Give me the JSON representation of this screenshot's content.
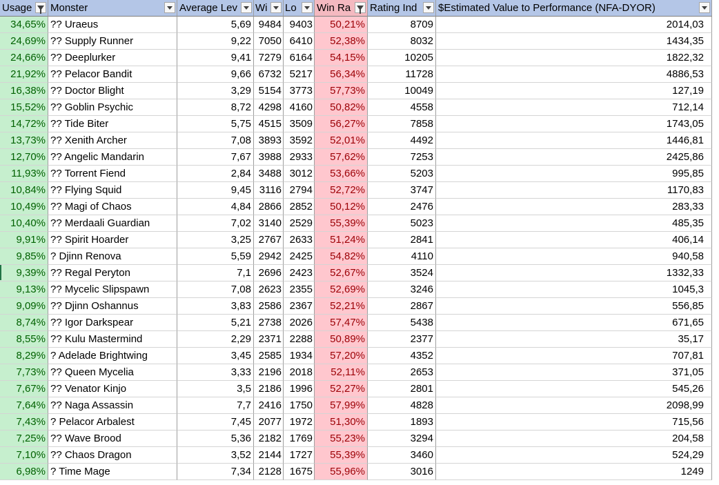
{
  "headers": {
    "usage": "Usage",
    "monster": "Monster",
    "avg_level": "Average Lev",
    "wins": "Wi",
    "losses": "Lo",
    "win_rate": "Win Ra",
    "rating": "Rating Ind",
    "value": "$Estimated Value to Performance (NFA-DYOR)"
  },
  "header_icons": {
    "usage": "filter-active-icon",
    "monster": "dropdown-arrow-icon",
    "avg_level": "dropdown-arrow-icon",
    "wins": "dropdown-arrow-icon",
    "losses": "dropdown-arrow-icon",
    "win_rate": "filter-active-icon",
    "rating": "dropdown-arrow-icon",
    "value": "dropdown-arrow-icon"
  },
  "colors": {
    "header_fill": "#b4c6e7",
    "win_rate_header_fill": "#f4b9c0",
    "usage_fill": "#c6efce",
    "usage_text": "#006100",
    "win_rate_fill": "#ffc7ce",
    "win_rate_text": "#9c0006"
  },
  "rows": [
    {
      "usage": "34,65%",
      "monster": "?? Uraeus",
      "avg": "5,69",
      "wins": "9484",
      "losses": "9403",
      "win_rate": "50,21%",
      "rating": "8709",
      "value": "2014,03"
    },
    {
      "usage": "24,69%",
      "monster": "?? Supply Runner",
      "avg": "9,22",
      "wins": "7050",
      "losses": "6410",
      "win_rate": "52,38%",
      "rating": "8032",
      "value": "1434,35"
    },
    {
      "usage": "24,66%",
      "monster": "?? Deeplurker",
      "avg": "9,41",
      "wins": "7279",
      "losses": "6164",
      "win_rate": "54,15%",
      "rating": "10205",
      "value": "1822,32"
    },
    {
      "usage": "21,92%",
      "monster": "?? Pelacor Bandit",
      "avg": "9,66",
      "wins": "6732",
      "losses": "5217",
      "win_rate": "56,34%",
      "rating": "11728",
      "value": "4886,53"
    },
    {
      "usage": "16,38%",
      "monster": "?? Doctor Blight",
      "avg": "3,29",
      "wins": "5154",
      "losses": "3773",
      "win_rate": "57,73%",
      "rating": "10049",
      "value": "127,19"
    },
    {
      "usage": "15,52%",
      "monster": "?? Goblin Psychic",
      "avg": "8,72",
      "wins": "4298",
      "losses": "4160",
      "win_rate": "50,82%",
      "rating": "4558",
      "value": "712,14"
    },
    {
      "usage": "14,72%",
      "monster": "?? Tide Biter",
      "avg": "5,75",
      "wins": "4515",
      "losses": "3509",
      "win_rate": "56,27%",
      "rating": "7858",
      "value": "1743,05"
    },
    {
      "usage": "13,73%",
      "monster": "?? Xenith Archer",
      "avg": "7,08",
      "wins": "3893",
      "losses": "3592",
      "win_rate": "52,01%",
      "rating": "4492",
      "value": "1446,81"
    },
    {
      "usage": "12,70%",
      "monster": "?? Angelic Mandarin",
      "avg": "7,67",
      "wins": "3988",
      "losses": "2933",
      "win_rate": "57,62%",
      "rating": "7253",
      "value": "2425,86"
    },
    {
      "usage": "11,93%",
      "monster": "?? Torrent Fiend",
      "avg": "2,84",
      "wins": "3488",
      "losses": "3012",
      "win_rate": "53,66%",
      "rating": "5203",
      "value": "995,85"
    },
    {
      "usage": "10,84%",
      "monster": "?? Flying Squid",
      "avg": "9,45",
      "wins": "3116",
      "losses": "2794",
      "win_rate": "52,72%",
      "rating": "3747",
      "value": "1170,83"
    },
    {
      "usage": "10,49%",
      "monster": "?? Magi of Chaos",
      "avg": "4,84",
      "wins": "2866",
      "losses": "2852",
      "win_rate": "50,12%",
      "rating": "2476",
      "value": "283,33"
    },
    {
      "usage": "10,40%",
      "monster": "?? Merdaali Guardian",
      "avg": "7,02",
      "wins": "3140",
      "losses": "2529",
      "win_rate": "55,39%",
      "rating": "5023",
      "value": "485,35"
    },
    {
      "usage": "9,91%",
      "monster": "?? Spirit Hoarder",
      "avg": "3,25",
      "wins": "2767",
      "losses": "2633",
      "win_rate": "51,24%",
      "rating": "2841",
      "value": "406,14"
    },
    {
      "usage": "9,85%",
      "monster": "? Djinn Renova",
      "avg": "5,59",
      "wins": "2942",
      "losses": "2425",
      "win_rate": "54,82%",
      "rating": "4110",
      "value": "940,58"
    },
    {
      "usage": "9,39%",
      "monster": "?? Regal Peryton",
      "avg": "7,1",
      "wins": "2696",
      "losses": "2423",
      "win_rate": "52,67%",
      "rating": "3524",
      "value": "1332,33"
    },
    {
      "usage": "9,13%",
      "monster": "?? Mycelic Slipspawn",
      "avg": "7,08",
      "wins": "2623",
      "losses": "2355",
      "win_rate": "52,69%",
      "rating": "3246",
      "value": "1045,3"
    },
    {
      "usage": "9,09%",
      "monster": "?? Djinn Oshannus",
      "avg": "3,83",
      "wins": "2586",
      "losses": "2367",
      "win_rate": "52,21%",
      "rating": "2867",
      "value": "556,85"
    },
    {
      "usage": "8,74%",
      "monster": "?? Igor Darkspear",
      "avg": "5,21",
      "wins": "2738",
      "losses": "2026",
      "win_rate": "57,47%",
      "rating": "5438",
      "value": "671,65"
    },
    {
      "usage": "8,55%",
      "monster": "?? Kulu Mastermind",
      "avg": "2,29",
      "wins": "2371",
      "losses": "2288",
      "win_rate": "50,89%",
      "rating": "2377",
      "value": "35,17"
    },
    {
      "usage": "8,29%",
      "monster": "? Adelade Brightwing",
      "avg": "3,45",
      "wins": "2585",
      "losses": "1934",
      "win_rate": "57,20%",
      "rating": "4352",
      "value": "707,81"
    },
    {
      "usage": "7,73%",
      "monster": "?? Queen Mycelia",
      "avg": "3,33",
      "wins": "2196",
      "losses": "2018",
      "win_rate": "52,11%",
      "rating": "2653",
      "value": "371,05"
    },
    {
      "usage": "7,67%",
      "monster": "?? Venator Kinjo",
      "avg": "3,5",
      "wins": "2186",
      "losses": "1996",
      "win_rate": "52,27%",
      "rating": "2801",
      "value": "545,26"
    },
    {
      "usage": "7,64%",
      "monster": "?? Naga Assassin",
      "avg": "7,7",
      "wins": "2416",
      "losses": "1750",
      "win_rate": "57,99%",
      "rating": "4828",
      "value": "2098,99"
    },
    {
      "usage": "7,43%",
      "monster": "? Pelacor Arbalest",
      "avg": "7,45",
      "wins": "2077",
      "losses": "1972",
      "win_rate": "51,30%",
      "rating": "1893",
      "value": "715,56"
    },
    {
      "usage": "7,25%",
      "monster": "?? Wave Brood",
      "avg": "5,36",
      "wins": "2182",
      "losses": "1769",
      "win_rate": "55,23%",
      "rating": "3294",
      "value": "204,58"
    },
    {
      "usage": "7,10%",
      "monster": "?? Chaos Dragon",
      "avg": "3,52",
      "wins": "2144",
      "losses": "1727",
      "win_rate": "55,39%",
      "rating": "3460",
      "value": "524,29"
    },
    {
      "usage": "6,98%",
      "monster": "? Time Mage",
      "avg": "7,34",
      "wins": "2128",
      "losses": "1675",
      "win_rate": "55,96%",
      "rating": "3016",
      "value": "1249"
    }
  ]
}
